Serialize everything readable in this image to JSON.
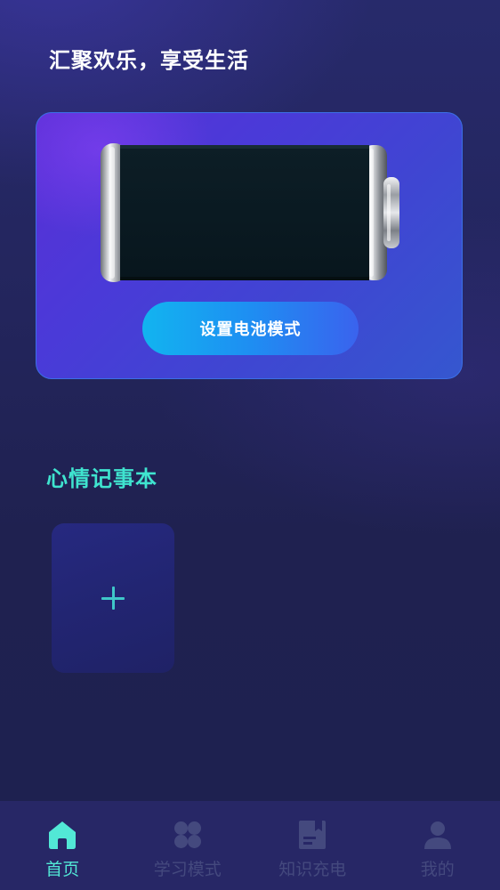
{
  "header": {
    "title": "汇聚欢乐，享受生活"
  },
  "battery_card": {
    "button_label": "设置电池模式"
  },
  "notes": {
    "title": "心情记事本"
  },
  "bottom_nav": {
    "items": [
      {
        "label": "首页",
        "icon": "home-icon",
        "active": true
      },
      {
        "label": "学习模式",
        "icon": "clover-icon",
        "active": false
      },
      {
        "label": "知识充电",
        "icon": "book-icon",
        "active": false
      },
      {
        "label": "我的",
        "icon": "user-icon",
        "active": false
      }
    ]
  },
  "colors": {
    "accent": "#52e8d6",
    "nav_inactive": "#44497e",
    "card_border": "#3b6fe6"
  }
}
